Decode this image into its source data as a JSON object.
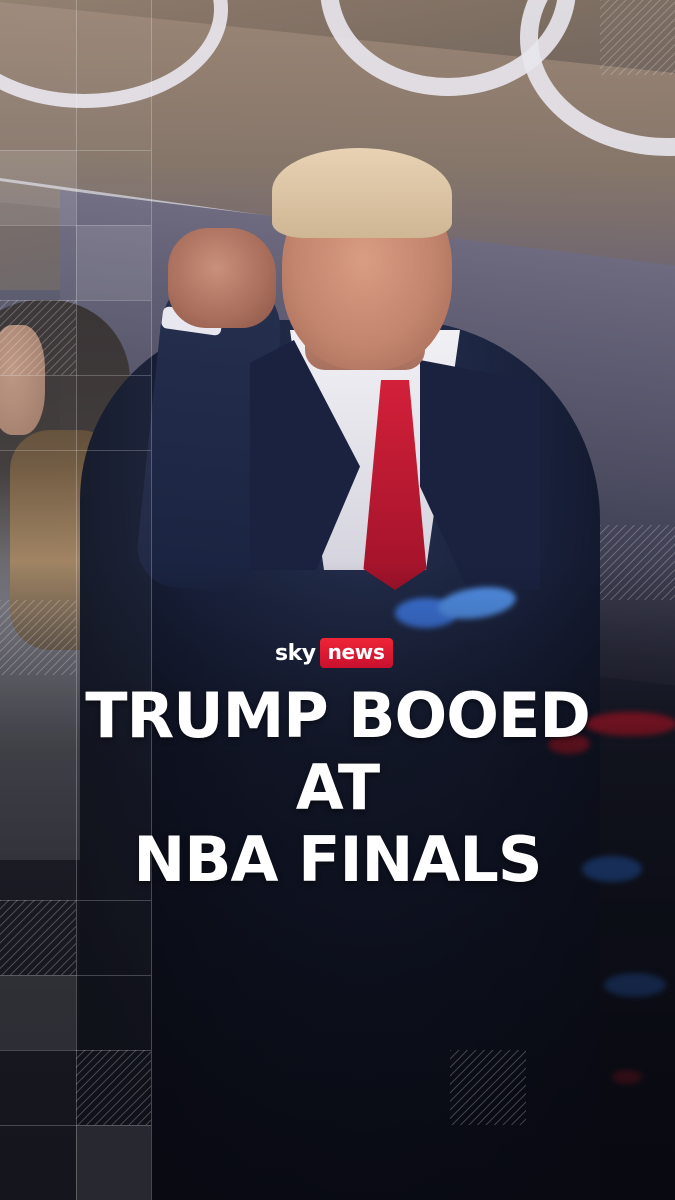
{
  "logo": {
    "brand": "sky",
    "product": "news"
  },
  "headline": {
    "line1": "TRUMP BOOED AT",
    "line2": "NBA FINALS"
  },
  "colors": {
    "news_red": "#c8102e",
    "tie_red": "#d3203a",
    "suit_navy": "#1a2240",
    "text": "#ffffff"
  }
}
